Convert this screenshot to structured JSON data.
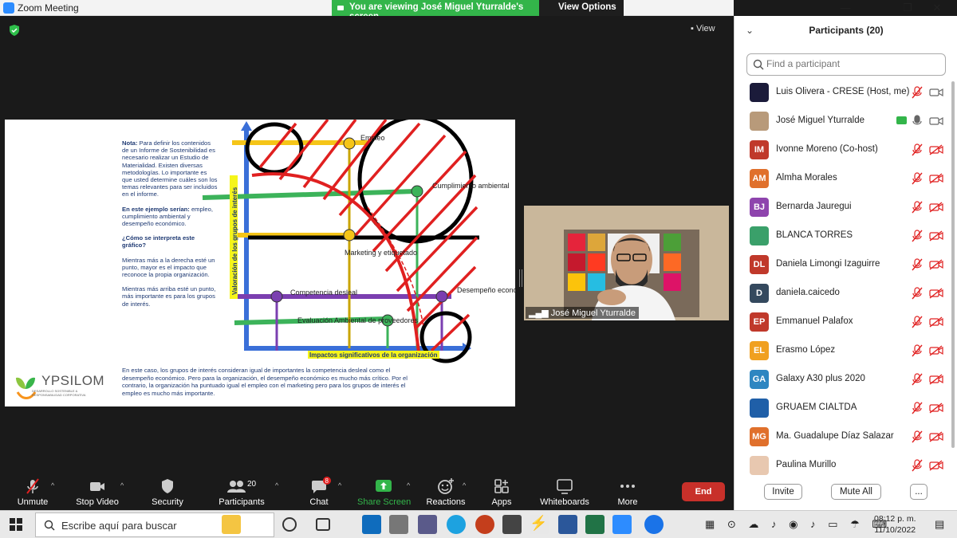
{
  "window": {
    "title": "Zoom Meeting",
    "viewing_banner": "You are viewing José Miguel Yturralde's screen",
    "view_options": "View Options"
  },
  "meeting": {
    "view_label": "View",
    "camera_name": "José Miguel Yturralde"
  },
  "slide": {
    "note_label": "Nota:",
    "note_text": " Para definir los contenidos de un Informe de Sostenibilidad es necesario realizar un Estudio de Materialidad. Existen diversas metodologías. Lo importante es que usted determine cuáles son los temas relevantes para ser incluidos en el informe.",
    "example_label": "En este ejemplo serían:",
    "example_text": " empleo, cumplimiento ambiental y desempeño económico.",
    "how_label": "¿Cómo se interpreta este gráfico?",
    "how_text1": "Mientras más a la derecha esté un punto, mayor es el impacto que reconoce la propia organización.",
    "how_text2": "Mientras más arriba esté un punto, más importante es para los grupos de interés.",
    "bottom_text": "En este caso, los grupos de interés consideran igual de importantes la competencia desleal como el desempeño económico. Pero para la organización, el desempeño económico es mucho más crítico. Por el contrario, la organización ha puntuado igual el empleo con el marketing pero para los grupos de interés el empleo es mucho más importante.",
    "logo_text": "YPSILOM",
    "logo_sub": "DESARROLLO SOSTENIBLE & RESPONSABILIDAD CORPORATIVA",
    "chart": {
      "ylabel": "Valoración de los grupos de interés",
      "xlabel": "Impactos significativos de la organización",
      "labels": {
        "empleo": "Empleo",
        "cumplimiento": "Cumplimiento ambiental",
        "marketing": "Marketing y etiquetado",
        "competencia": "Competencia desleal",
        "desempeno": "Desempeño económico",
        "evaluacion": "Evaluación Ambiental de proveedores"
      }
    }
  },
  "toolbar": {
    "unmute": "Unmute",
    "stop_video": "Stop Video",
    "security": "Security",
    "participants": "Participants",
    "participants_count": "20",
    "chat": "Chat",
    "chat_badge": "8",
    "share_screen": "Share Screen",
    "reactions": "Reactions",
    "apps": "Apps",
    "whiteboards": "Whiteboards",
    "more": "More",
    "end": "End"
  },
  "panel": {
    "title": "Participants (20)",
    "search_placeholder": "Find a participant",
    "invite": "Invite",
    "mute_all": "Mute All",
    "more": "...",
    "participants": [
      {
        "name": "Luis Olivera - CRESE (Host, me)",
        "initials": "",
        "color": "#1b1b3a"
      },
      {
        "name": "José Miguel Yturralde",
        "initials": "",
        "color": "#b89a7a"
      },
      {
        "name": "Ivonne Moreno (Co-host)",
        "initials": "IM",
        "color": "#c0392b"
      },
      {
        "name": "Almha Morales",
        "initials": "AM",
        "color": "#e0702c"
      },
      {
        "name": "Bernarda Jauregui",
        "initials": "BJ",
        "color": "#8e44ad"
      },
      {
        "name": "BLANCA TORRES",
        "initials": "",
        "color": "#3aa06a"
      },
      {
        "name": "Daniela Limongi Izaguirre",
        "initials": "DL",
        "color": "#c0392b"
      },
      {
        "name": "daniela.caicedo",
        "initials": "D",
        "color": "#34495e"
      },
      {
        "name": "Emmanuel Palafox",
        "initials": "EP",
        "color": "#c0392b"
      },
      {
        "name": "Erasmo López",
        "initials": "EL",
        "color": "#f0a020"
      },
      {
        "name": "Galaxy A30 plus 2020",
        "initials": "GA",
        "color": "#2e86c1"
      },
      {
        "name": "GRUAEM CIALTDA",
        "initials": "",
        "color": "#1f5fa8"
      },
      {
        "name": "Ma. Guadalupe Díaz Salazar",
        "initials": "MG",
        "color": "#e0702c"
      },
      {
        "name": "Paulina Murillo",
        "initials": "",
        "color": "#e8c8b0"
      }
    ]
  },
  "taskbar": {
    "search_text": "Escribe aquí para buscar",
    "time": "08:12 p. m.",
    "date": "11/10/2022"
  }
}
